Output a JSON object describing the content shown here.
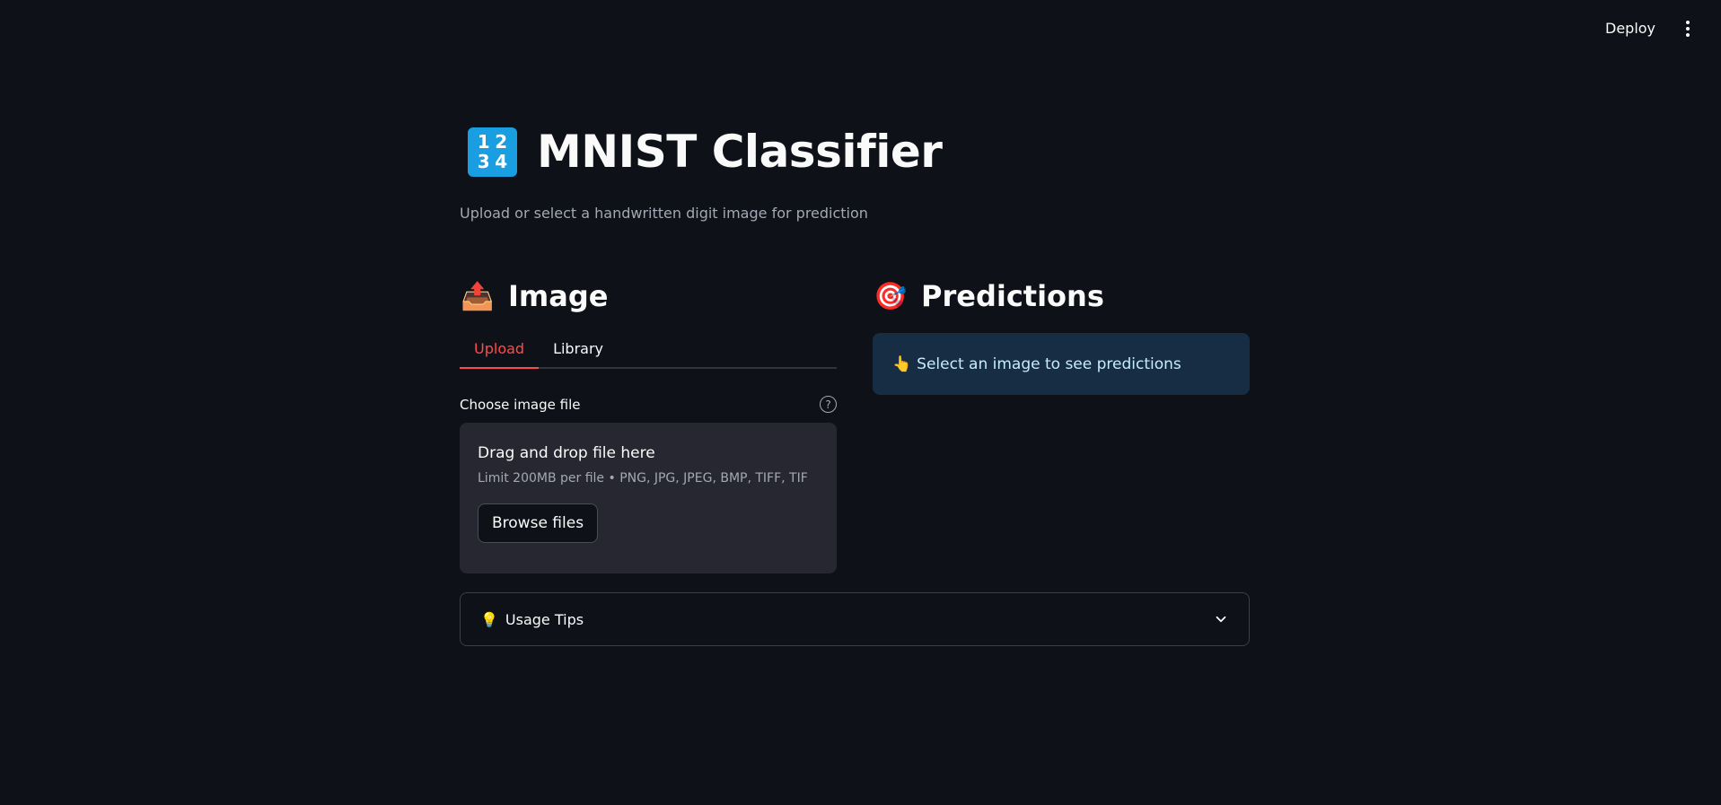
{
  "header": {
    "deploy_label": "Deploy",
    "menu_icon": "vertical-ellipsis-icon"
  },
  "title": {
    "icon": "numbers-1234-icon",
    "icon_digits": [
      "1",
      "2",
      "3",
      "4"
    ],
    "text": "MNIST Classifier",
    "subtitle": "Upload or select a handwritten digit image for prediction"
  },
  "image_section": {
    "emoji": "📤",
    "heading": "Image",
    "tabs": [
      {
        "label": "Upload",
        "active": true
      },
      {
        "label": "Library",
        "active": false
      }
    ],
    "file_label": "Choose image file",
    "help_icon": "question-circle-icon",
    "dropzone": {
      "title": "Drag and drop file here",
      "limit": "Limit 200MB per file • PNG, JPG, JPEG, BMP, TIFF, TIF",
      "browse_label": "Browse files"
    }
  },
  "predictions_section": {
    "emoji": "🎯",
    "heading": "Predictions",
    "info_emoji": "👆",
    "info_text": "Select an image to see predictions"
  },
  "usage_tips": {
    "emoji": "💡",
    "label": "Usage Tips",
    "expanded": false,
    "chevron_icon": "chevron-down-icon"
  },
  "colors": {
    "background": "#0e1117",
    "accent": "#ff4b4b",
    "info_bg": "#172d43",
    "dropzone_bg": "#262730"
  }
}
